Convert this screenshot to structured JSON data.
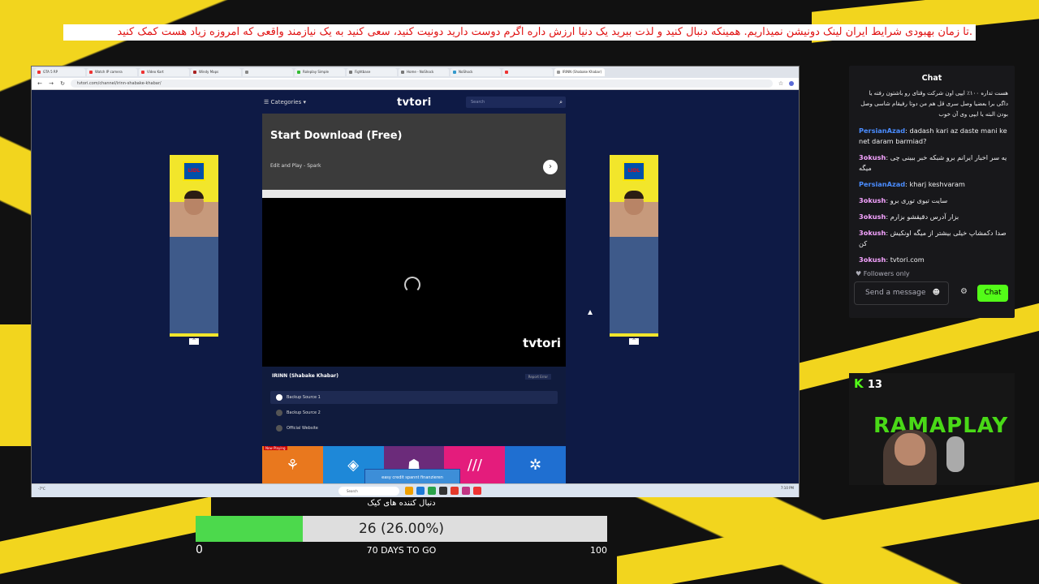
{
  "overlay": {
    "top_message": ".تا زمان بهبودی شرایط ایران لینک دونیشن نمیذاریم. همینکه دنبال کنید و لذت ببرید یک دنیا ارزش داره اگرم دوست دارید دونیت کنید، سعی کنید به یک نیازمند واقعی که امروزه زیاد هست کمک کنید"
  },
  "browser": {
    "tabs": [
      {
        "label": "GTA 5 RP",
        "color": "#e33"
      },
      {
        "label": "Watch IP camera",
        "color": "#e33"
      },
      {
        "label": "Video Kart",
        "color": "#e33"
      },
      {
        "label": "Windy Maps",
        "color": "#a22"
      },
      {
        "label": "",
        "color": "#888"
      },
      {
        "label": "Roleplay Simple",
        "color": "#3b3"
      },
      {
        "label": "Fightbase",
        "color": "#777"
      },
      {
        "label": "Home - NoShock",
        "color": "#777"
      },
      {
        "label": "NoShock",
        "color": "#39c"
      },
      {
        "label": "",
        "color": "#e33"
      },
      {
        "label": "IRINN (Shabake Khabar)",
        "color": "#999"
      }
    ],
    "url": "tvtori.com/channel/irinn-shabake-khabar/"
  },
  "site": {
    "categories": "Categories",
    "logo": "tvtori",
    "search_placeholder": "Search",
    "ad_title": "Start Download (Free)",
    "ad_subtitle": "Edit and Play - Spark",
    "watermark": "tvtori",
    "channel_title": "IRINN (Shabake Khabar)",
    "report": "Report Error",
    "sources": [
      "Backup Source 1",
      "Backup Source 2",
      "Official Website"
    ],
    "now_playing": "Now Playing",
    "mini_ad": "easy credit  spannt finanzieren",
    "side_ad_brand": "LIDL"
  },
  "taskbar": {
    "weather": "-7°C",
    "search": "Search",
    "time": "7:10 PM"
  },
  "chat": {
    "title": "Chat",
    "messages": [
      {
        "user": "",
        "text": "هست تداره ۱۰۰٪ ایپی اون شرکت وقتای رو باشتون رفته یا داگی برا بعضیا وصل سری قل هم من دوتا رفیقام شاسی وصل بودن البته یا ایپی وی آن خوب",
        "color": "#efeff1",
        "rtl": true
      },
      {
        "user": "PersianAzad",
        "text": "dadash kari az daste mani ke net daram barmiad?",
        "color": "#4a8cff",
        "rtl": false
      },
      {
        "user": "3okush",
        "text": "یه سر اخبار ایرانم برو شبکه خبر ببینی چی میگه",
        "color": "#f5a3ff",
        "rtl": false
      },
      {
        "user": "PersianAzad",
        "text": "kharj keshvaram",
        "color": "#4a8cff",
        "rtl": false
      },
      {
        "user": "3okush",
        "text": "سایت تیوی توری برو",
        "color": "#f5a3ff",
        "rtl": false
      },
      {
        "user": "3okush",
        "text": "بزار آدرس دقیقشو بزارم",
        "color": "#f5a3ff",
        "rtl": false
      },
      {
        "user": "3okush",
        "text": "صدا دکمشاپ خیلی بیشتر از میگه اونکیش کن",
        "color": "#f5a3ff",
        "rtl": false
      },
      {
        "user": "3okush",
        "text": "tvtori.com",
        "color": "#f5a3ff",
        "rtl": false
      }
    ],
    "followers_only": "Followers only",
    "input_placeholder": "Send a message",
    "send_label": "Chat"
  },
  "cam": {
    "badge": "K",
    "badge_count": "13",
    "bg_text": "RAMAPLAY"
  },
  "goal": {
    "title": "دنبال کننده های کیک",
    "current": 26,
    "max": 100,
    "progress_text": "26 (26.00%)",
    "min_label": "0",
    "max_label": "100",
    "days_text": "70 DAYS TO GO",
    "fill_fraction": 0.26
  }
}
